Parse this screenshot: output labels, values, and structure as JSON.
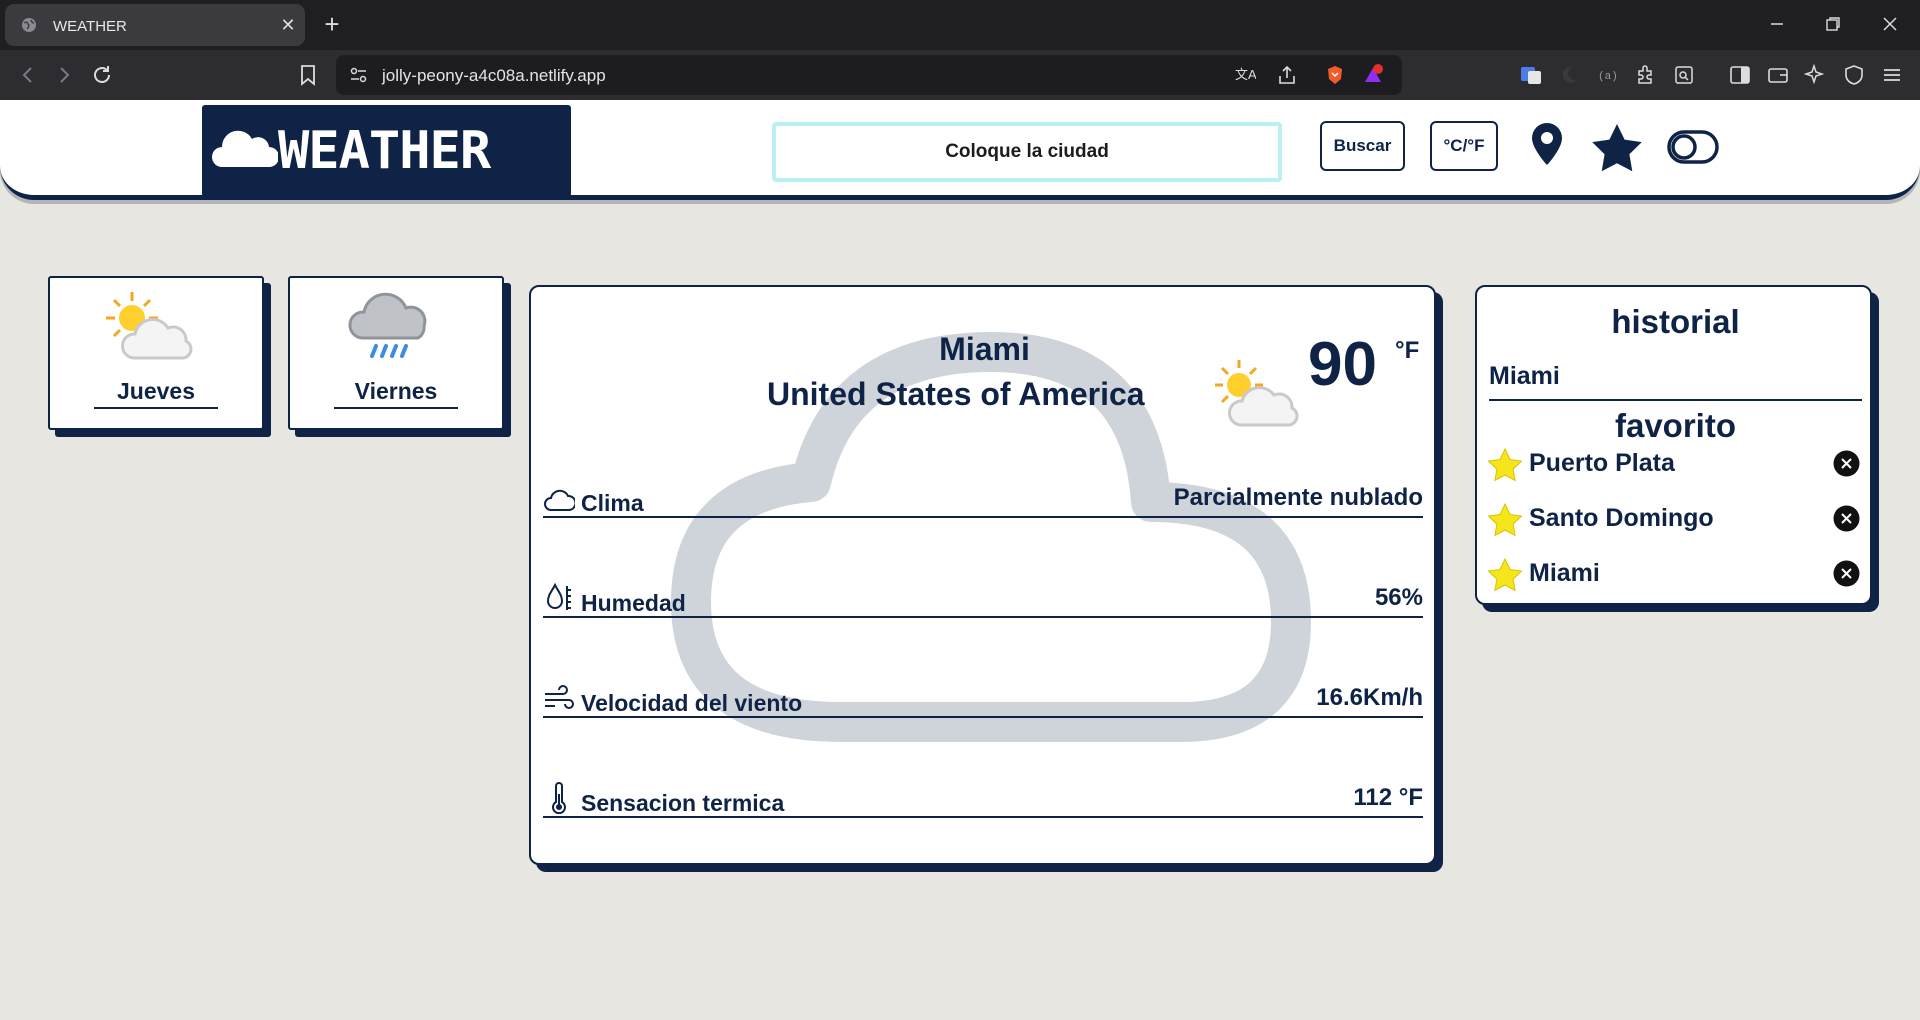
{
  "browser": {
    "tab_title": "WEATHER",
    "url": "jolly-peony-a4c08a.netlify.app",
    "brave_badge": "1"
  },
  "header": {
    "logo_text": "WEATHER",
    "search_placeholder": "Coloque la ciudad",
    "search_button": "Buscar",
    "unit_toggle_button": "°C/°F"
  },
  "forecast": [
    {
      "day": "Jueves",
      "icon": "partly-cloudy-icon"
    },
    {
      "day": "Viernes",
      "icon": "rain-cloud-icon"
    }
  ],
  "current": {
    "city": "Miami",
    "country": "United States of America",
    "temperature": "90",
    "unit": "°F",
    "icon": "partly-cloudy-icon",
    "details": [
      {
        "icon": "cloud-outline-icon",
        "label": "Clima",
        "value": "Parcialmente nublado"
      },
      {
        "icon": "humidity-icon",
        "label": "Humedad",
        "value": "56%"
      },
      {
        "icon": "wind-icon",
        "label": "Velocidad del viento",
        "value": "16.6Km/h"
      },
      {
        "icon": "thermometer-icon",
        "label": "Sensacion termica",
        "value": "112 °F"
      }
    ]
  },
  "sidebar": {
    "history_title": "historial",
    "history_items": [
      "Miami"
    ],
    "favorites_title": "favorito",
    "favorites": [
      "Puerto Plata",
      "Santo Domingo",
      "Miami"
    ]
  },
  "colors": {
    "navy": "#0f2347",
    "page_bg": "#e8e6e1",
    "search_border": "#b8f0f3",
    "star": "#f7e51c"
  }
}
